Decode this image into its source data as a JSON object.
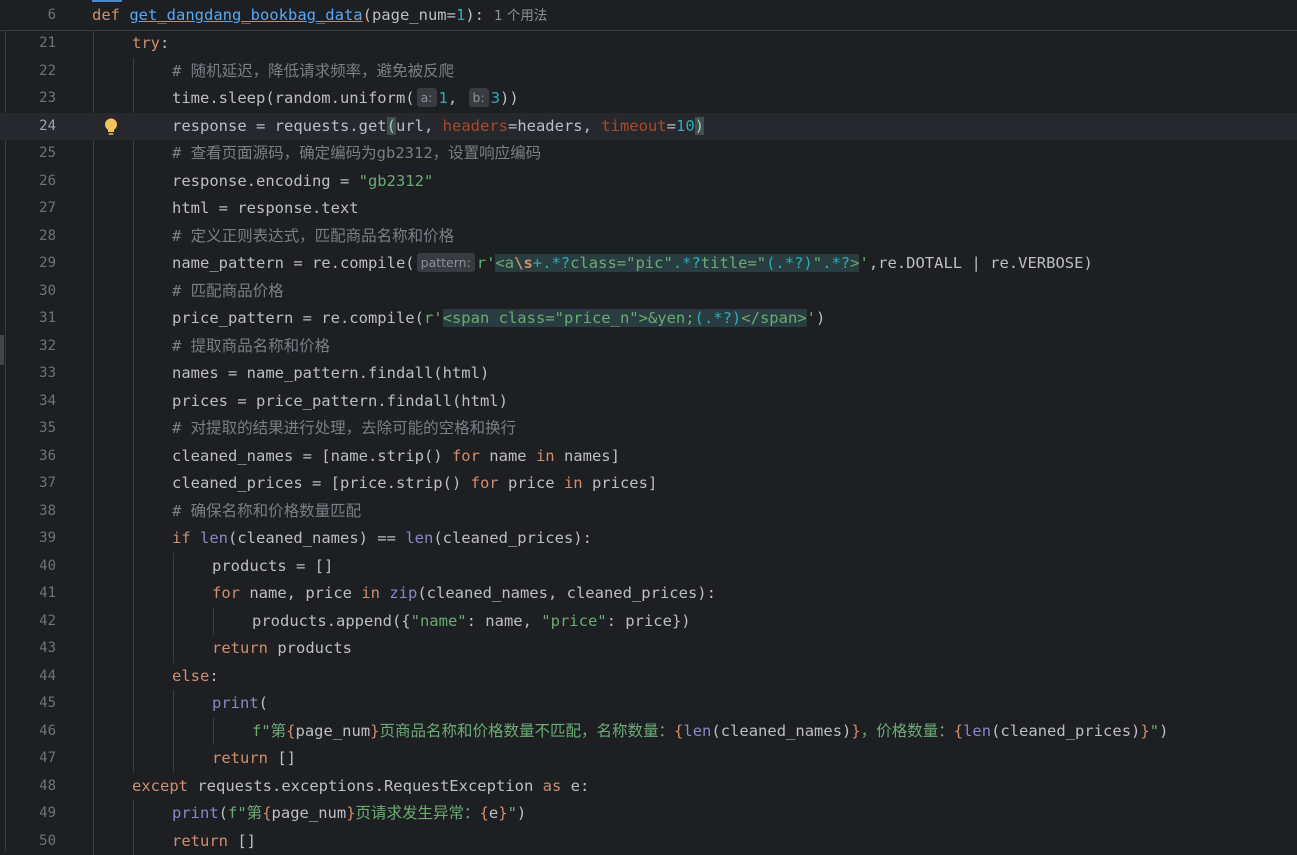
{
  "sticky": {
    "line_no": "6",
    "def_kw": "def",
    "func_name": "get_dangdang_bookbag_data",
    "sig_open": "(page_num=",
    "default_val": "1",
    "sig_close": "):",
    "usages": "1 个用法"
  },
  "lines": [
    {
      "no": "21",
      "t": [
        [
          "kw",
          "try"
        ],
        [
          "plain",
          ":"
        ]
      ]
    },
    {
      "no": "22",
      "t": [
        [
          "cmt",
          "# 随机延迟，降低请求频率，避免被反爬"
        ]
      ]
    },
    {
      "no": "23",
      "t": [
        [
          "plain",
          "time.sleep(random.uniform("
        ],
        [
          "hint",
          "a:"
        ],
        [
          "num",
          "1"
        ],
        [
          "plain",
          ", "
        ],
        [
          "hint",
          "b:"
        ],
        [
          "num",
          "3"
        ],
        [
          "plain",
          "))"
        ]
      ]
    },
    {
      "no": "24",
      "t": [
        [
          "plain",
          "response = requests.get"
        ],
        [
          "brk",
          "("
        ],
        [
          "plain",
          "url, "
        ],
        [
          "param",
          "headers"
        ],
        [
          "plain",
          "=headers, "
        ],
        [
          "param",
          "timeout"
        ],
        [
          "plain",
          "="
        ],
        [
          "num",
          "10"
        ],
        [
          "brk",
          ")"
        ]
      ]
    },
    {
      "no": "25",
      "t": [
        [
          "cmt",
          "# 查看页面源码，确定编码为gb2312，设置响应编码"
        ]
      ]
    },
    {
      "no": "26",
      "t": [
        [
          "plain",
          "response.encoding = "
        ],
        [
          "str",
          "\"gb2312\""
        ]
      ]
    },
    {
      "no": "27",
      "t": [
        [
          "plain",
          "html = response.text"
        ]
      ]
    },
    {
      "no": "28",
      "t": [
        [
          "cmt",
          "# 定义正则表达式，匹配商品名称和价格"
        ]
      ]
    },
    {
      "no": "29",
      "t": [
        [
          "plain",
          "name_pattern = re.compile("
        ],
        [
          "hint",
          "pattern:"
        ],
        [
          "str",
          "r'"
        ],
        [
          "rxs",
          "<a"
        ],
        [
          "rxesc",
          "\\s"
        ],
        [
          "rxm",
          "+.*?"
        ],
        [
          "rxs",
          "class=\"pic\""
        ],
        [
          "rxm",
          ".*?"
        ],
        [
          "rxs",
          "title=\""
        ],
        [
          "rxm",
          "(.*?)"
        ],
        [
          "rxs",
          "\""
        ],
        [
          "rxm",
          ".*?"
        ],
        [
          "rxs",
          ">"
        ],
        [
          "str",
          "'"
        ],
        [
          "plain",
          ",re.DOTALL | re.VERBOSE)"
        ]
      ]
    },
    {
      "no": "30",
      "t": [
        [
          "cmt",
          "# 匹配商品价格"
        ]
      ]
    },
    {
      "no": "31",
      "t": [
        [
          "plain",
          "price_pattern = re.compile("
        ],
        [
          "str",
          "r'"
        ],
        [
          "rxs",
          "<span class=\"price_n\">&yen;"
        ],
        [
          "rxm",
          "(.*?)"
        ],
        [
          "rxs",
          "</span>"
        ],
        [
          "str",
          "'"
        ],
        [
          "plain",
          ")"
        ]
      ]
    },
    {
      "no": "32",
      "t": [
        [
          "cmt",
          "# 提取商品名称和价格"
        ]
      ]
    },
    {
      "no": "33",
      "t": [
        [
          "plain",
          "names = name_pattern.findall(html)"
        ]
      ]
    },
    {
      "no": "34",
      "t": [
        [
          "plain",
          "prices = price_pattern.findall(html)"
        ]
      ]
    },
    {
      "no": "35",
      "t": [
        [
          "cmt",
          "# 对提取的结果进行处理，去除可能的空格和换行"
        ]
      ]
    },
    {
      "no": "36",
      "t": [
        [
          "plain",
          "cleaned_names = [name.strip() "
        ],
        [
          "kw",
          "for"
        ],
        [
          "plain",
          " name "
        ],
        [
          "kw",
          "in"
        ],
        [
          "plain",
          " names]"
        ]
      ]
    },
    {
      "no": "37",
      "t": [
        [
          "plain",
          "cleaned_prices = [price.strip() "
        ],
        [
          "kw",
          "for"
        ],
        [
          "plain",
          " price "
        ],
        [
          "kw",
          "in"
        ],
        [
          "plain",
          " prices]"
        ]
      ]
    },
    {
      "no": "38",
      "t": [
        [
          "cmt",
          "# 确保名称和价格数量匹配"
        ]
      ]
    },
    {
      "no": "39",
      "t": [
        [
          "kw",
          "if "
        ],
        [
          "bi",
          "len"
        ],
        [
          "plain",
          "(cleaned_names) == "
        ],
        [
          "bi",
          "len"
        ],
        [
          "plain",
          "(cleaned_prices):"
        ]
      ]
    },
    {
      "no": "40",
      "t": [
        [
          "plain",
          "products = []"
        ]
      ]
    },
    {
      "no": "41",
      "t": [
        [
          "kw",
          "for"
        ],
        [
          "plain",
          " name, price "
        ],
        [
          "kw",
          "in "
        ],
        [
          "bi",
          "zip"
        ],
        [
          "plain",
          "(cleaned_names, cleaned_prices):"
        ]
      ]
    },
    {
      "no": "42",
      "t": [
        [
          "plain",
          "products.append({"
        ],
        [
          "str",
          "\"name\""
        ],
        [
          "plain",
          ": name, "
        ],
        [
          "str",
          "\"price\""
        ],
        [
          "plain",
          ": price})"
        ]
      ]
    },
    {
      "no": "43",
      "t": [
        [
          "kw",
          "return"
        ],
        [
          "plain",
          " products"
        ]
      ]
    },
    {
      "no": "44",
      "t": [
        [
          "kw",
          "else"
        ],
        [
          "plain",
          ":"
        ]
      ]
    },
    {
      "no": "45",
      "t": [
        [
          "bi",
          "print"
        ],
        [
          "plain",
          "("
        ]
      ]
    },
    {
      "no": "46",
      "t": [
        [
          "str",
          "f\"第"
        ],
        [
          "kw",
          "{"
        ],
        [
          "plain",
          "page_num"
        ],
        [
          "kw",
          "}"
        ],
        [
          "str",
          "页商品名称和价格数量不匹配，名称数量："
        ],
        [
          "kw",
          "{"
        ],
        [
          "bi",
          "len"
        ],
        [
          "plain",
          "(cleaned_names)"
        ],
        [
          "kw",
          "}"
        ],
        [
          "str",
          "，价格数量："
        ],
        [
          "kw",
          "{"
        ],
        [
          "bi",
          "len"
        ],
        [
          "plain",
          "(cleaned_prices)"
        ],
        [
          "kw",
          "}"
        ],
        [
          "str",
          "\""
        ],
        [
          "plain",
          ")"
        ]
      ]
    },
    {
      "no": "47",
      "t": [
        [
          "kw",
          "return"
        ],
        [
          "plain",
          " []"
        ]
      ]
    },
    {
      "no": "48",
      "t": [
        [
          "kw",
          "except"
        ],
        [
          "plain",
          " requests.exceptions.RequestException "
        ],
        [
          "kw",
          "as"
        ],
        [
          "plain",
          " e:"
        ]
      ]
    },
    {
      "no": "49",
      "t": [
        [
          "bi",
          "print"
        ],
        [
          "plain",
          "("
        ],
        [
          "str",
          "f\"第"
        ],
        [
          "kw",
          "{"
        ],
        [
          "plain",
          "page_num"
        ],
        [
          "kw",
          "}"
        ],
        [
          "str",
          "页请求发生异常："
        ],
        [
          "kw",
          "{"
        ],
        [
          "plain",
          "e"
        ],
        [
          "kw",
          "}"
        ],
        [
          "str",
          "\""
        ],
        [
          "plain",
          ")"
        ]
      ]
    },
    {
      "no": "50",
      "t": [
        [
          "kw",
          "return"
        ],
        [
          "plain",
          " []"
        ]
      ]
    }
  ]
}
